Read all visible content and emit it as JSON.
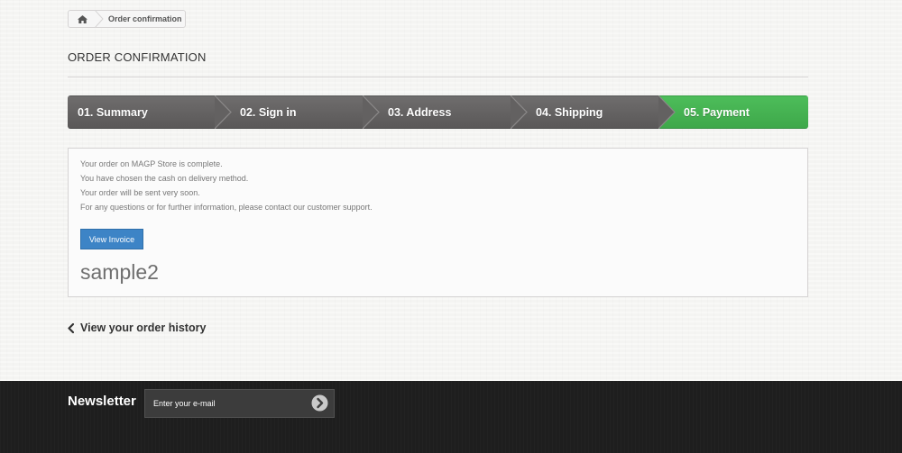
{
  "breadcrumb": {
    "home_icon": "home-icon",
    "current": "Order confirmation"
  },
  "page": {
    "title": "ORDER CONFIRMATION"
  },
  "steps": [
    {
      "label": "01. Summary",
      "state": "done"
    },
    {
      "label": "02. Sign in",
      "state": "done"
    },
    {
      "label": "03. Address",
      "state": "done"
    },
    {
      "label": "04. Shipping",
      "state": "done"
    },
    {
      "label": "05. Payment",
      "state": "current"
    }
  ],
  "confirmation": {
    "lines": [
      "Your order on MAGP Store is complete.",
      "You have chosen the cash on delivery method.",
      "Your order will be sent very soon.",
      "For any questions or for further information, please contact our customer support."
    ],
    "invoice_button": "View Invoice",
    "order_reference": "sample2"
  },
  "history_link": {
    "icon": "chevron-left-icon",
    "label": "View your order history"
  },
  "footer": {
    "newsletter_title": "Newsletter",
    "email_placeholder": "Enter your e-mail",
    "submit_icon": "arrow-right-circle-icon"
  },
  "colors": {
    "step_default": "#5f5d5d",
    "step_current": "#46b552",
    "invoice_button": "#3d84c6",
    "footer_bg": "#1e1e1e"
  }
}
